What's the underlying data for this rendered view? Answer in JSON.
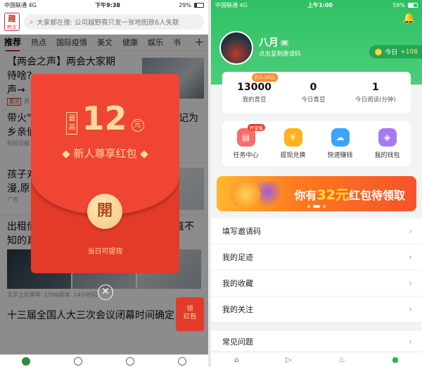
{
  "left": {
    "status": {
      "carrier": "中国联通",
      "network": "4G",
      "time": "下午9:38",
      "battery": "29%"
    },
    "app_logo": {
      "top": "趣",
      "bottom": "热文"
    },
    "search": {
      "text": "大家都在搜: 公司越野赛只发一张地图致6人失联"
    },
    "tabs": [
      "推荐",
      "热点",
      "国际疫情",
      "美文",
      "健康",
      "娱乐",
      "书"
    ],
    "news": [
      {
        "title_line1": "【两会之声】两会大家期",
        "title_line2": "待啥?",
        "title_line3": "声→",
        "tag": "置顶",
        "source": "央"
      },
      {
        "title_line1": "带火\"",
        "title_line2": "乡亲们",
        "right": "记为",
        "source": "科技日报"
      },
      {
        "title_line1": "孩子对",
        "title_line2": "漫,原",
        "source": "广告"
      },
      {
        "title_line1": "出租借",
        "right1": "直不",
        "title_line2": "知的真",
        "right2": ""
      },
      {
        "source": "文学上的青年",
        "reads": "1596阅读",
        "time": "14小时前"
      },
      {
        "title_line1": "十三届全国人大三次会议闭幕时间确定"
      }
    ],
    "envelope": {
      "zui": "最高",
      "amount": "12",
      "unit": "元",
      "title": "新人尊享红包",
      "open": "開",
      "sub": "当日可提现"
    },
    "close": "✕",
    "ling": {
      "line1": "领",
      "line2": "红包"
    }
  },
  "right": {
    "status": {
      "carrier": "中国联通",
      "network": "4G",
      "time": "上午1:00",
      "battery": "59%"
    },
    "user": {
      "name": "八月",
      "vip": "V",
      "copy_hint": "点击复制邀请码"
    },
    "today": {
      "label": "今日",
      "plus": "+108"
    },
    "stats": [
      {
        "value": "13000",
        "label": "我的青豆",
        "bubble": "约1.30元"
      },
      {
        "value": "0",
        "label": "今日青豆"
      },
      {
        "value": "1",
        "label": "今日阅读(分钟)"
      }
    ],
    "grid": [
      {
        "label": "任务中心",
        "badge": "开宝箱",
        "icon": "task-icon",
        "color": "#ff6a6a"
      },
      {
        "label": "提现兑换",
        "icon": "wallet-icon",
        "color": "#ffb21c"
      },
      {
        "label": "快速赚钱",
        "icon": "cloud-icon",
        "color": "#3aa4ff"
      },
      {
        "label": "我的钱包",
        "icon": "purse-icon",
        "color": "#a57bf1"
      }
    ],
    "banner": {
      "prefix": "你有",
      "amount": "32元",
      "suffix": "红包待领取"
    },
    "menu": [
      "填写邀请码",
      "我的足迹",
      "我的收藏",
      "我的关注"
    ],
    "menu2": [
      "常见问题"
    ],
    "tabbar": [
      "home-icon",
      "video-icon",
      "fire-icon",
      "profile-icon"
    ]
  }
}
